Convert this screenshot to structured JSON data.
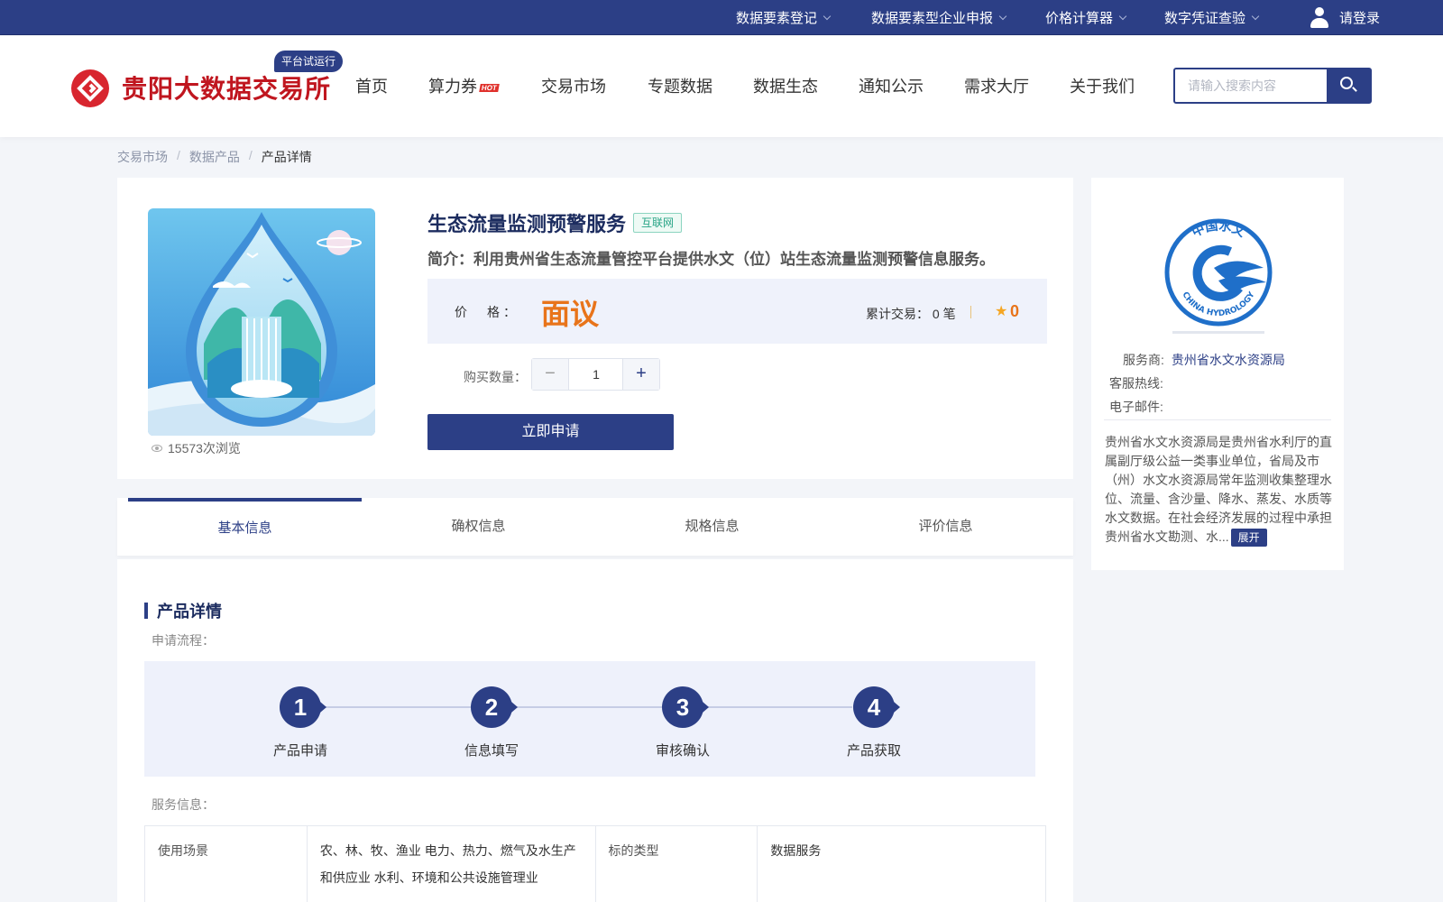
{
  "topbar": {
    "items": [
      {
        "label": "数据要素登记"
      },
      {
        "label": "数据要素型企业申报"
      },
      {
        "label": "价格计算器"
      },
      {
        "label": "数字凭证查验"
      }
    ],
    "login_label": "请登录",
    "bg_color": "#2c3f86"
  },
  "header": {
    "logo_text": "贵阳大数据交易所",
    "beta_badge": "平台试运行",
    "nav": [
      {
        "label": "首页"
      },
      {
        "label": "算力券",
        "badge": "HOT"
      },
      {
        "label": "交易市场"
      },
      {
        "label": "专题数据"
      },
      {
        "label": "数据生态"
      },
      {
        "label": "通知公示"
      },
      {
        "label": "需求大厅"
      },
      {
        "label": "关于我们"
      }
    ],
    "search": {
      "placeholder": "请输入搜索内容",
      "value": ""
    }
  },
  "breadcrumb": [
    "交易市场",
    "数据产品",
    "产品详情"
  ],
  "breadcrumb_sep": "/",
  "product": {
    "title": "生态流量监测预警服务",
    "tag": "互联网",
    "intro": "简介：利用贵州省生态流量管控平台提供水文（位）站生态流量监测预警信息服务。",
    "views": "15573次浏览",
    "price_label_a": "价",
    "price_label_b": "格：",
    "price_value": "面议",
    "trades_label": "累计交易：",
    "trades_value": "0 笔",
    "rating": "0",
    "qty_label": "购买数量：",
    "qty_value": "1",
    "apply_label": "立即申请",
    "accent_color": "#e8741a"
  },
  "tabs": [
    {
      "label": "基本信息",
      "active": true
    },
    {
      "label": "确权信息"
    },
    {
      "label": "规格信息"
    },
    {
      "label": "评价信息"
    }
  ],
  "detail": {
    "section_title": "产品详情",
    "flow_label": "申请流程：",
    "steps": [
      {
        "num": "1",
        "name": "产品申请"
      },
      {
        "num": "2",
        "name": "信息填写"
      },
      {
        "num": "3",
        "name": "审核确认"
      },
      {
        "num": "4",
        "name": "产品获取"
      }
    ],
    "service_label": "服务信息：",
    "table": [
      {
        "k1": "使用场景",
        "v1": "农、林、牧、渔业 电力、热力、燃气及水生产和供应业 水利、环境和公共设施管理业",
        "k2": "标的类型",
        "v2": "数据服务"
      }
    ]
  },
  "provider": {
    "logo_cn": "中国水文",
    "logo_en": "CHINA HYDROLOGY",
    "name_label": "服务商:",
    "name": "贵州省水文水资源局",
    "hotline_label": "客服热线:",
    "email_label": "电子邮件:",
    "desc": "贵州省水文水资源局是贵州省水利厅的直属副厅级公益一类事业单位，省局及市（州）水文水资源局常年监测收集整理水位、流量、含沙量、降水、蒸发、水质等水文数据。在社会经济发展的过程中承担贵州省水文勘测、水...",
    "expand_label": "展开",
    "brand_color": "#1f6fc9"
  }
}
